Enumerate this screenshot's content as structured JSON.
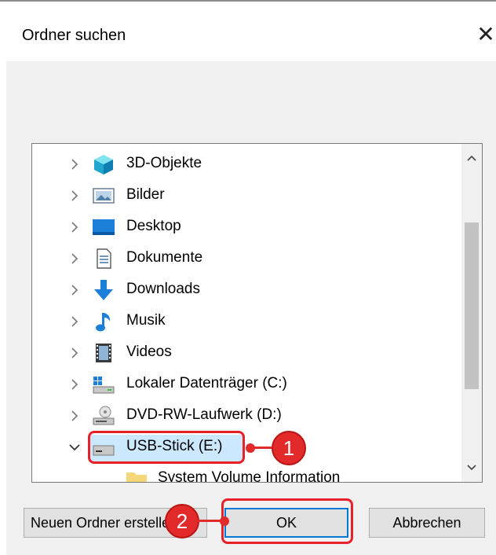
{
  "dialog": {
    "title": "Ordner suchen",
    "close_icon": "close-icon"
  },
  "tree": {
    "items": [
      {
        "label": "3D-Objekte",
        "icon": "3d-objects-icon",
        "expanded": false
      },
      {
        "label": "Bilder",
        "icon": "pictures-icon",
        "expanded": false
      },
      {
        "label": "Desktop",
        "icon": "desktop-icon",
        "expanded": false
      },
      {
        "label": "Dokumente",
        "icon": "documents-icon",
        "expanded": false
      },
      {
        "label": "Downloads",
        "icon": "downloads-icon",
        "expanded": false
      },
      {
        "label": "Musik",
        "icon": "music-icon",
        "expanded": false
      },
      {
        "label": "Videos",
        "icon": "videos-icon",
        "expanded": false
      },
      {
        "label": "Lokaler Datenträger (C:)",
        "icon": "local-disk-icon",
        "expanded": false
      },
      {
        "label": "DVD-RW-Laufwerk (D:)",
        "icon": "dvd-drive-icon",
        "expanded": false
      },
      {
        "label": "USB-Stick (E:)",
        "icon": "usb-drive-icon",
        "expanded": true,
        "selected": true
      },
      {
        "label": "System Volume Information",
        "icon": "folder-icon",
        "expanded": false
      }
    ]
  },
  "buttons": {
    "new_folder": "Neuen Ordner erstellen",
    "ok": "OK",
    "cancel": "Abbrechen"
  },
  "annotations": {
    "step1": "1",
    "step2": "2"
  },
  "colors": {
    "accent": "#0078d7",
    "selection": "#cce8ff",
    "annotation_red": "#e32a2a"
  }
}
